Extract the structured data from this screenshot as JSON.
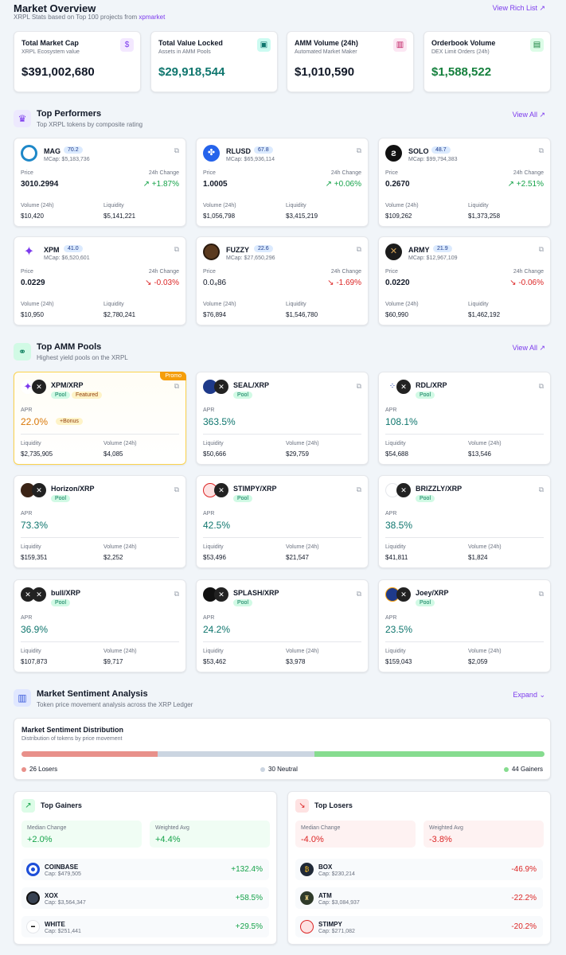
{
  "header": {
    "title": "Market Overview",
    "subtitle_prefix": "XRPL Stats based on Top 100 projects from ",
    "subtitle_link": "xpmarket",
    "rich_list_link": "View Rich List ↗"
  },
  "stats": [
    {
      "title": "Total Market Cap",
      "sub": "XRPL Ecosystem value",
      "value": "$391,002,680",
      "icon": "$",
      "color": "#111827"
    },
    {
      "title": "Total Value Locked",
      "sub": "Assets in AMM Pools",
      "value": "$29,918,544",
      "icon": "▣",
      "color": "#0f766e"
    },
    {
      "title": "AMM Volume (24h)",
      "sub": "Automated Market Maker",
      "value": "$1,010,590",
      "icon": "▥",
      "color": "#111827"
    },
    {
      "title": "Orderbook Volume",
      "sub": "DEX Limit Orders (24h)",
      "value": "$1,588,522",
      "icon": "▤",
      "color": "#15803d"
    }
  ],
  "performers": {
    "title": "Top Performers",
    "subtitle": "Top XRPL tokens by composite rating",
    "view_all": "View All ↗",
    "labels": {
      "price": "Price",
      "change": "24h Change",
      "volume": "Volume (24h)",
      "liquidity": "Liquidity"
    },
    "items": [
      {
        "name": "MAG",
        "score": "70.2",
        "mcap": "MCap: $5,183,736",
        "price": "3010.2994",
        "change": "↗ +1.87%",
        "dir": "up",
        "volume": "$10,420",
        "liquidity": "$5,141,221"
      },
      {
        "name": "RLUSD",
        "score": "67.8",
        "mcap": "MCap: $65,936,114",
        "price": "1.0005",
        "change": "↗ +0.06%",
        "dir": "up",
        "volume": "$1,056,798",
        "liquidity": "$3,415,219"
      },
      {
        "name": "SOLO",
        "score": "48.7",
        "mcap": "MCap: $99,794,383",
        "price": "0.2670",
        "change": "↗ +2.51%",
        "dir": "up",
        "volume": "$109,262",
        "liquidity": "$1,373,258"
      },
      {
        "name": "XPM",
        "score": "41.0",
        "mcap": "MCap: $6,520,601",
        "price": "0.0229",
        "change": "↘ -0.03%",
        "dir": "down",
        "volume": "$10,950",
        "liquidity": "$2,780,241"
      },
      {
        "name": "FUZZY",
        "score": "22.6",
        "mcap": "MCap: $27,650,296",
        "price": "0.0₄86",
        "change": "↘ -1.69%",
        "dir": "down",
        "volume": "$76,894",
        "liquidity": "$1,546,780"
      },
      {
        "name": "ARMY",
        "score": "21.9",
        "mcap": "MCap: $12,967,109",
        "price": "0.0220",
        "change": "↘ -0.06%",
        "dir": "down",
        "volume": "$60,990",
        "liquidity": "$1,462,192"
      }
    ]
  },
  "pools": {
    "title": "Top AMM Pools",
    "subtitle": "Highest yield pools on the XRPL",
    "view_all": "View All ↗",
    "labels": {
      "apr": "APR",
      "liquidity": "Liquidity",
      "volume": "Volume (24h)",
      "pool": "Pool",
      "featured": "Featured",
      "promo": "Promo",
      "bonus": "+Bonus"
    },
    "items": [
      {
        "name": "XPM/XRP",
        "apr": "22.0%",
        "liquidity": "$2,735,905",
        "volume": "$4,085"
      },
      {
        "name": "SEAL/XRP",
        "apr": "363.5%",
        "liquidity": "$50,666",
        "volume": "$29,759"
      },
      {
        "name": "RDL/XRP",
        "apr": "108.1%",
        "liquidity": "$54,688",
        "volume": "$13,546"
      },
      {
        "name": "Horizon/XRP",
        "apr": "73.3%",
        "liquidity": "$159,351",
        "volume": "$2,252"
      },
      {
        "name": "STIMPY/XRP",
        "apr": "42.5%",
        "liquidity": "$53,496",
        "volume": "$21,547"
      },
      {
        "name": "BRIZZLY/XRP",
        "apr": "38.5%",
        "liquidity": "$41,811",
        "volume": "$1,824"
      },
      {
        "name": "bull/XRP",
        "apr": "36.9%",
        "liquidity": "$107,873",
        "volume": "$9,717"
      },
      {
        "name": "SPLASH/XRP",
        "apr": "24.2%",
        "liquidity": "$53,462",
        "volume": "$3,978"
      },
      {
        "name": "Joey/XRP",
        "apr": "23.5%",
        "liquidity": "$159,043",
        "volume": "$2,059"
      }
    ]
  },
  "sentiment": {
    "title": "Market Sentiment Analysis",
    "subtitle": "Token price movement analysis across the XRP Ledger",
    "expand": "Expand ⌄",
    "dist_title": "Market Sentiment Distribution",
    "dist_sub": "Distribution of tokens by price movement",
    "losers": 26,
    "neutral": 30,
    "gainers": 44,
    "losers_label": "26 Losers",
    "neutral_label": "30 Neutral",
    "gainers_label": "44 Gainers",
    "colors": {
      "losers": "#e8908a",
      "neutral": "#cbd5e1",
      "gainers": "#86dc8f"
    }
  },
  "gainers": {
    "title": "Top Gainers",
    "median_label": "Median Change",
    "median": "+2.0%",
    "weighted_label": "Weighted Avg",
    "weighted": "+4.4%",
    "items": [
      {
        "name": "COINBASE",
        "cap": "Cap: $479,505",
        "value": "+132.4%"
      },
      {
        "name": "XOX",
        "cap": "Cap: $3,564,347",
        "value": "+58.5%"
      },
      {
        "name": "WHITE",
        "cap": "Cap: $251,441",
        "value": "+29.5%"
      }
    ]
  },
  "losers": {
    "title": "Top Losers",
    "median_label": "Median Change",
    "median": "-4.0%",
    "weighted_label": "Weighted Avg",
    "weighted": "-3.8%",
    "items": [
      {
        "name": "BOX",
        "cap": "Cap: $230,214",
        "value": "-46.9%"
      },
      {
        "name": "ATM",
        "cap": "Cap: $3,084,937",
        "value": "-22.2%"
      },
      {
        "name": "STIMPY",
        "cap": "Cap: $271,082",
        "value": "-20.2%"
      }
    ]
  }
}
